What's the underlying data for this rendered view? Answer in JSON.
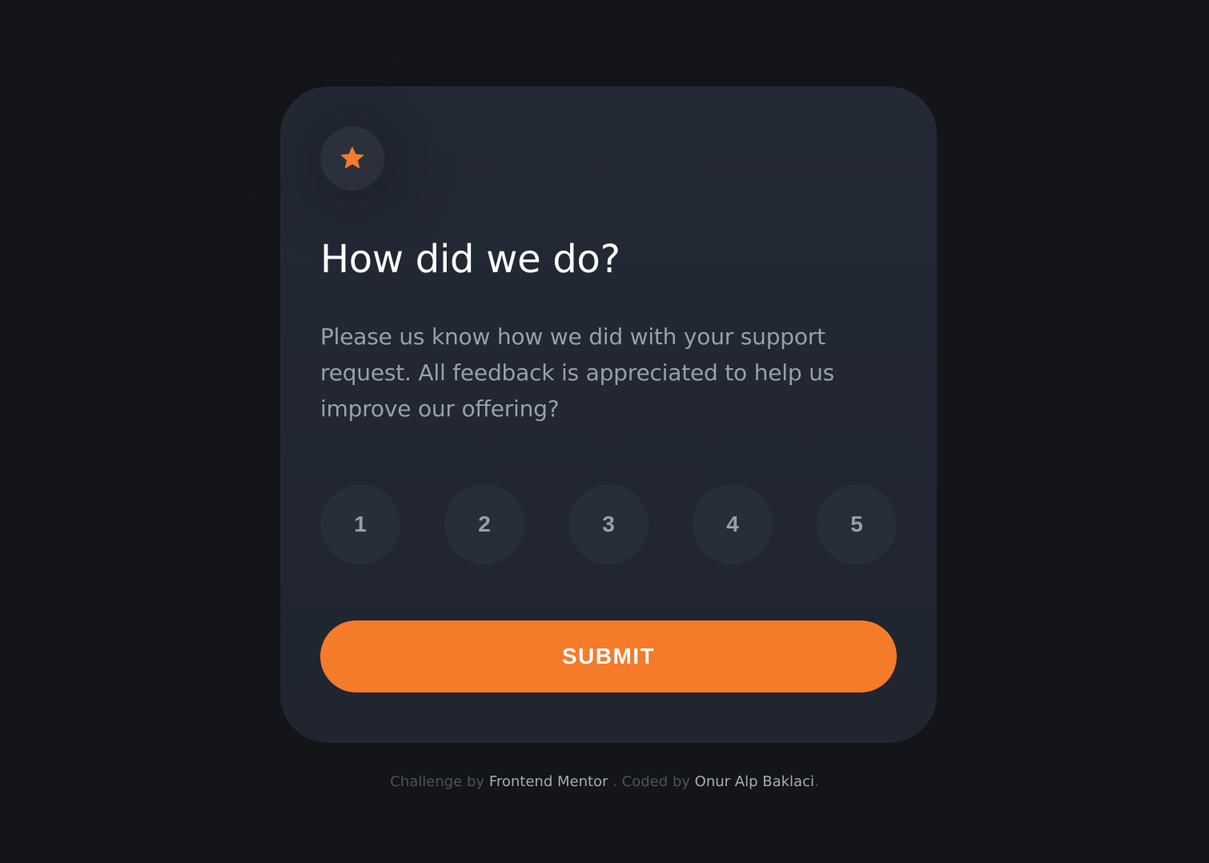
{
  "card": {
    "icon": "star-icon",
    "title": "How did we do?",
    "description": "Please us know how we did with your support request. All feedback is appreciated to help us improve our offering?",
    "ratings": [
      "1",
      "2",
      "3",
      "4",
      "5"
    ],
    "submit_label": "SUBMIT"
  },
  "footer": {
    "prefix": "Challenge by",
    "challenge_link": "Frontend Mentor",
    "middle": ". Coded by",
    "author_link": "Onur Alp Baklaci",
    "suffix": "."
  },
  "colors": {
    "page_background": "#131518",
    "card_background": "#232935",
    "accent": "#f47b2a",
    "rating_background": "#262e38",
    "muted_text": "#969fad"
  }
}
